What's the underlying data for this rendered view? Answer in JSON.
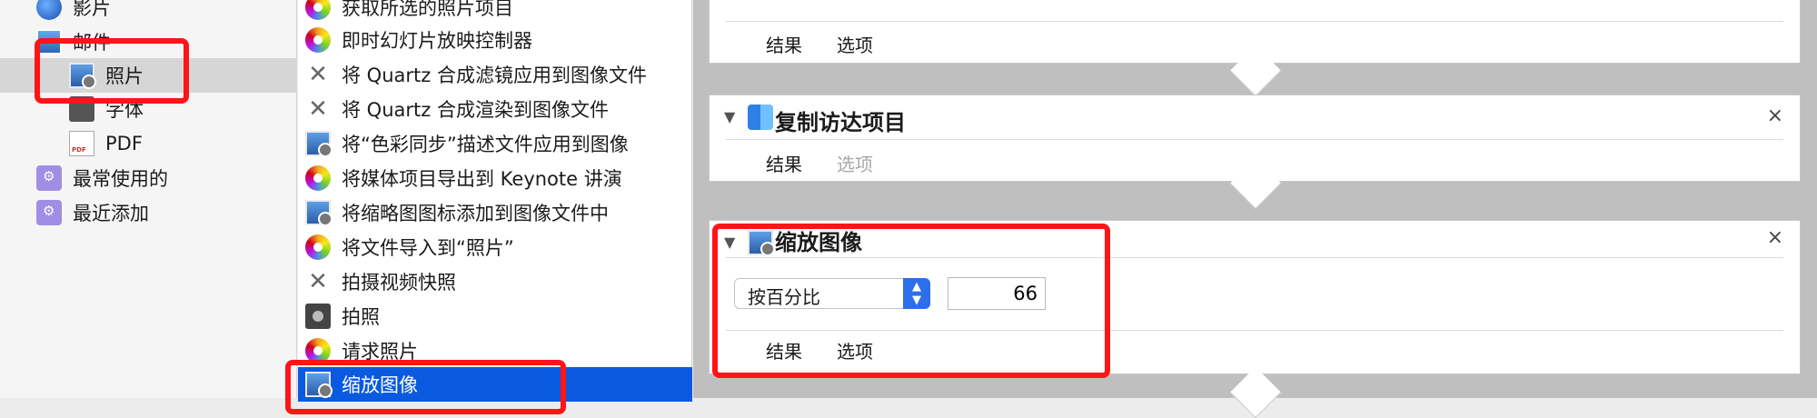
{
  "library": {
    "items": [
      {
        "label": "影片",
        "icon": "quicktime-icon"
      },
      {
        "label": "邮件",
        "icon": "mail-icon"
      },
      {
        "label": "照片",
        "icon": "photo-icon"
      },
      {
        "label": "字体",
        "icon": "font-icon"
      },
      {
        "label": "PDF",
        "icon": "pdf-icon"
      },
      {
        "label": "最常使用的",
        "icon": "smart-folder-icon"
      },
      {
        "label": "最近添加",
        "icon": "smart-folder-icon"
      }
    ]
  },
  "actions": {
    "items": [
      {
        "label": "获取所选的照片项目",
        "icon": "photos-flower-icon"
      },
      {
        "label": "即时幻灯片放映控制器",
        "icon": "photos-flower-icon"
      },
      {
        "label": "将 Quartz 合成滤镜应用到图像文件",
        "icon": "tools-icon"
      },
      {
        "label": "将 Quartz 合成渲染到图像文件",
        "icon": "tools-icon"
      },
      {
        "label": "将“色彩同步”描述文件应用到图像",
        "icon": "preview-icon"
      },
      {
        "label": "将媒体项目导出到 Keynote 讲演",
        "icon": "photos-flower-icon"
      },
      {
        "label": "将缩略图图标添加到图像文件中",
        "icon": "preview-icon"
      },
      {
        "label": "将文件导入到“照片”",
        "icon": "photos-flower-icon"
      },
      {
        "label": "拍摄视频快照",
        "icon": "tools-icon"
      },
      {
        "label": "拍照",
        "icon": "camera-icon"
      },
      {
        "label": "请求照片",
        "icon": "photos-flower-icon"
      },
      {
        "label": "缩放图像",
        "icon": "preview-icon"
      }
    ]
  },
  "workflow": {
    "card_results": "结果",
    "card_options": "选项",
    "copy_finder": {
      "title": "复制访达项目",
      "results": "结果",
      "options": "选项",
      "close": "×"
    },
    "scale_image": {
      "title": "缩放图像",
      "results": "结果",
      "options": "选项",
      "close": "×",
      "mode": "按百分比",
      "value": "66"
    }
  },
  "colors": {
    "selection_blue": "#0a5ae0",
    "highlight_red": "#ff1418"
  }
}
